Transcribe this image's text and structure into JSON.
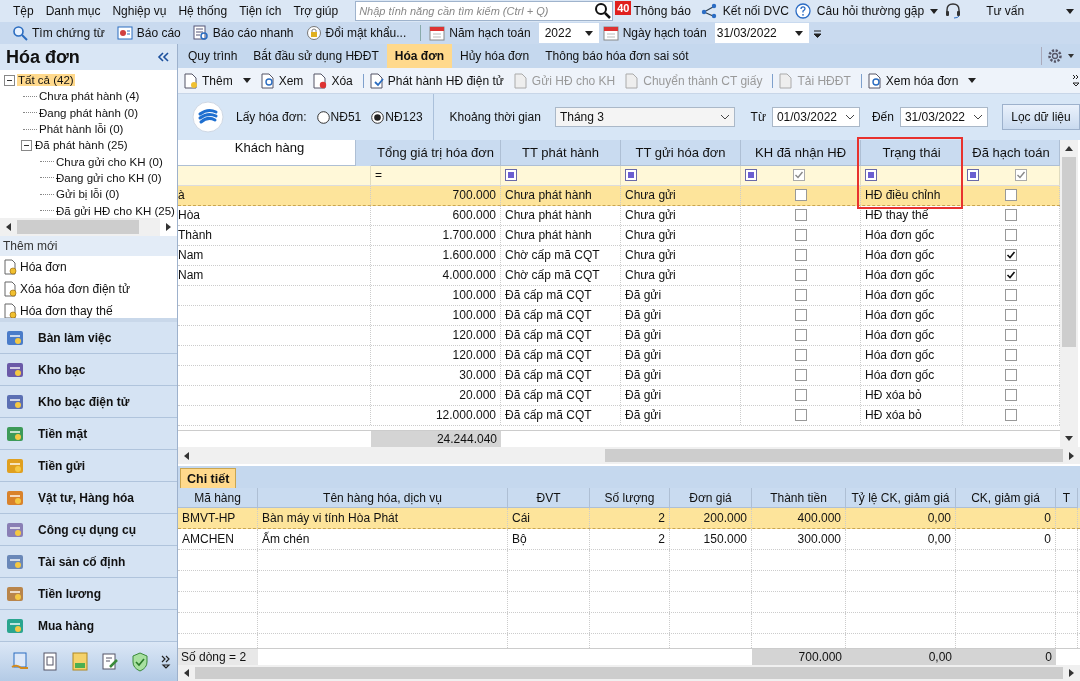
{
  "menu_bar": {
    "items": [
      "Tệp",
      "Danh mục",
      "Nghiệp vụ",
      "Hệ thống",
      "Tiện ích",
      "Trợ giúp"
    ],
    "search": {
      "placeholder": "Nhập tính năng cần tìm kiếm (Ctrl + Q)"
    },
    "notification": {
      "badge": "40",
      "label": "Thông báo"
    },
    "connect": "Kết nối DVC",
    "faq": "Câu hỏi thường gặp",
    "advice": "Tư vấn"
  },
  "toolbar": {
    "items": [
      "Tìm chứng từ",
      "Báo cáo",
      "Báo cáo nhanh",
      "Đổi mật khẩu..."
    ],
    "year": {
      "label": "Năm hạch toán",
      "value": "2022"
    },
    "date": {
      "label": "Ngày hạch toán",
      "value": "31/03/2022"
    }
  },
  "sidebar": {
    "title": "Hóa đơn",
    "tree": [
      {
        "label": "Tất cả (42)",
        "selected": true,
        "expanded": true,
        "children": [
          {
            "label": "Chưa phát hành (4)",
            "selected": false
          },
          {
            "label": "Đang phát hành (0)",
            "selected": false
          },
          {
            "label": "Phát hành lỗi (0)",
            "selected": false
          },
          {
            "label": "Đã phát hành (25)",
            "selected": false,
            "expanded": true,
            "children": [
              {
                "label": "Chưa gửi cho KH (0)",
                "selected": false
              },
              {
                "label": "Đang gửi cho KH (0)",
                "selected": false
              },
              {
                "label": "Gửi bị lỗi (0)",
                "selected": false
              },
              {
                "label": "Đã gửi HĐ cho KH (25)",
                "selected": false
              }
            ]
          }
        ]
      }
    ],
    "quick_add": {
      "title": "Thêm mới",
      "items": [
        "Hóa đơn",
        "Xóa hóa đơn điện tử",
        "Hóa đơn thay thế"
      ]
    },
    "modules": [
      "Bàn làm việc",
      "Kho bạc",
      "Kho bạc điện tử",
      "Tiền mặt",
      "Tiền gửi",
      "Vật tư, Hàng hóa",
      "Công cụ dụng cụ",
      "Tài sản cố định",
      "Tiền lương",
      "Mua hàng"
    ]
  },
  "tabs": [
    {
      "label": "Quy trình",
      "selected": false
    },
    {
      "label": "Bắt đầu sử dụng HĐĐT",
      "selected": false
    },
    {
      "label": "Hóa đơn",
      "selected": true
    },
    {
      "label": "Hủy hóa đơn",
      "selected": false
    },
    {
      "label": "Thông báo hóa đơn sai sót",
      "selected": false
    }
  ],
  "actions": [
    {
      "label": "Thêm",
      "disabled": false,
      "dropdown": true
    },
    {
      "label": "Xem",
      "disabled": false,
      "dropdown": false
    },
    {
      "label": "Xóa",
      "disabled": false,
      "dropdown": false
    },
    {
      "label": "Phát hành HĐ điện tử",
      "disabled": false,
      "dropdown": false
    },
    {
      "label": "Gửi HĐ cho KH",
      "disabled": true,
      "dropdown": false
    },
    {
      "label": "Chuyển thành CT giấy",
      "disabled": true,
      "dropdown": false
    },
    {
      "label": "Tải HĐĐT",
      "disabled": true,
      "dropdown": false
    },
    {
      "label": "Xem hóa đơn",
      "disabled": false,
      "dropdown": true
    }
  ],
  "filter": {
    "source_label": "Lấy hóa đơn:",
    "sources": [
      {
        "label": "NĐ51",
        "selected": false
      },
      {
        "label": "NĐ123",
        "selected": true
      }
    ],
    "period_label": "Khoảng thời gian",
    "period": "Tháng 3",
    "from_label": "Từ",
    "from": "01/03/2022",
    "to_label": "Đến",
    "to": "31/03/2022",
    "button": "Lọc dữ liệu"
  },
  "table": {
    "columns": [
      "Khách hàng",
      "Tổng giá trị hóa đơn",
      "TT phát hành",
      "TT gửi hóa đơn",
      "KH đã nhận HĐ",
      "Trạng thái",
      "Đã hạch toán"
    ],
    "filter_row": [
      {
        "kind": "blank"
      },
      {
        "kind": "operator",
        "text": "="
      },
      {
        "kind": "square"
      },
      {
        "kind": "square"
      },
      {
        "kind": "square_check",
        "checked": true
      },
      {
        "kind": "square"
      },
      {
        "kind": "square_check",
        "checked": true
      }
    ],
    "rows": [
      {
        "customer": "à",
        "total": "700.000",
        "issue": "Chưa phát hành",
        "send": "Chưa gửi",
        "received": false,
        "status": "HĐ điều chỉnh",
        "posted": false,
        "selected": true
      },
      {
        "customer": "Hòa",
        "total": "600.000",
        "issue": "Chưa phát hành",
        "send": "Chưa gửi",
        "received": false,
        "status": "HĐ thay thế",
        "posted": false,
        "selected": false
      },
      {
        "customer": "Thành",
        "total": "1.700.000",
        "issue": "Chưa phát hành",
        "send": "Chưa gửi",
        "received": false,
        "status": "Hóa đơn gốc",
        "posted": false,
        "selected": false
      },
      {
        "customer": "Nam",
        "total": "1.600.000",
        "issue": "Chờ cấp mã CQT",
        "send": "Chưa gửi",
        "received": false,
        "status": "Hóa đơn gốc",
        "posted": true,
        "selected": false
      },
      {
        "customer": "Nam",
        "total": "4.000.000",
        "issue": "Chờ cấp mã CQT",
        "send": "Chưa gửi",
        "received": false,
        "status": "Hóa đơn gốc",
        "posted": true,
        "selected": false
      },
      {
        "customer": "",
        "total": "100.000",
        "issue": "Đã cấp mã CQT",
        "send": "Đã gửi",
        "received": false,
        "status": "Hóa đơn gốc",
        "posted": false,
        "selected": false
      },
      {
        "customer": "",
        "total": "100.000",
        "issue": "Đã cấp mã CQT",
        "send": "Đã gửi",
        "received": false,
        "status": "Hóa đơn gốc",
        "posted": false,
        "selected": false
      },
      {
        "customer": "",
        "total": "120.000",
        "issue": "Đã cấp mã CQT",
        "send": "Đã gửi",
        "received": false,
        "status": "Hóa đơn gốc",
        "posted": false,
        "selected": false
      },
      {
        "customer": "",
        "total": "120.000",
        "issue": "Đã cấp mã CQT",
        "send": "Đã gửi",
        "received": false,
        "status": "Hóa đơn gốc",
        "posted": false,
        "selected": false
      },
      {
        "customer": "",
        "total": "30.000",
        "issue": "Đã cấp mã CQT",
        "send": "Đã gửi",
        "received": false,
        "status": "Hóa đơn gốc",
        "posted": false,
        "selected": false
      },
      {
        "customer": "",
        "total": "20.000",
        "issue": "Đã cấp mã CQT",
        "send": "Đã gửi",
        "received": false,
        "status": "HĐ xóa bỏ",
        "posted": false,
        "selected": false
      },
      {
        "customer": "",
        "total": "12.000.000",
        "issue": "Đã cấp mã CQT",
        "send": "Đã gửi",
        "received": false,
        "status": "HĐ xóa bỏ",
        "posted": false,
        "selected": false
      }
    ],
    "total": "24.244.040"
  },
  "detail": {
    "tab": "Chi tiết",
    "columns": [
      "Mã hàng",
      "Tên hàng hóa, dịch vụ",
      "ĐVT",
      "Số lượng",
      "Đơn giá",
      "Thành tiền",
      "Tỷ lệ CK, giảm giá",
      "CK, giảm giá",
      "T"
    ],
    "rows": [
      {
        "code": "BMVT-HP",
        "name": "Bàn máy vi tính Hòa Phát",
        "unit": "Cái",
        "qty": "2",
        "price": "200.000",
        "amount": "400.000",
        "rate": "0,00",
        "discount": "0",
        "selected": true
      },
      {
        "code": "AMCHEN",
        "name": "Ấm chén",
        "unit": "Bộ",
        "qty": "2",
        "price": "150.000",
        "amount": "300.000",
        "rate": "0,00",
        "discount": "0",
        "selected": false
      }
    ],
    "footer": {
      "label": "Số dòng = 2",
      "amount": "700.000",
      "rate": "0,00",
      "discount": "0"
    }
  }
}
